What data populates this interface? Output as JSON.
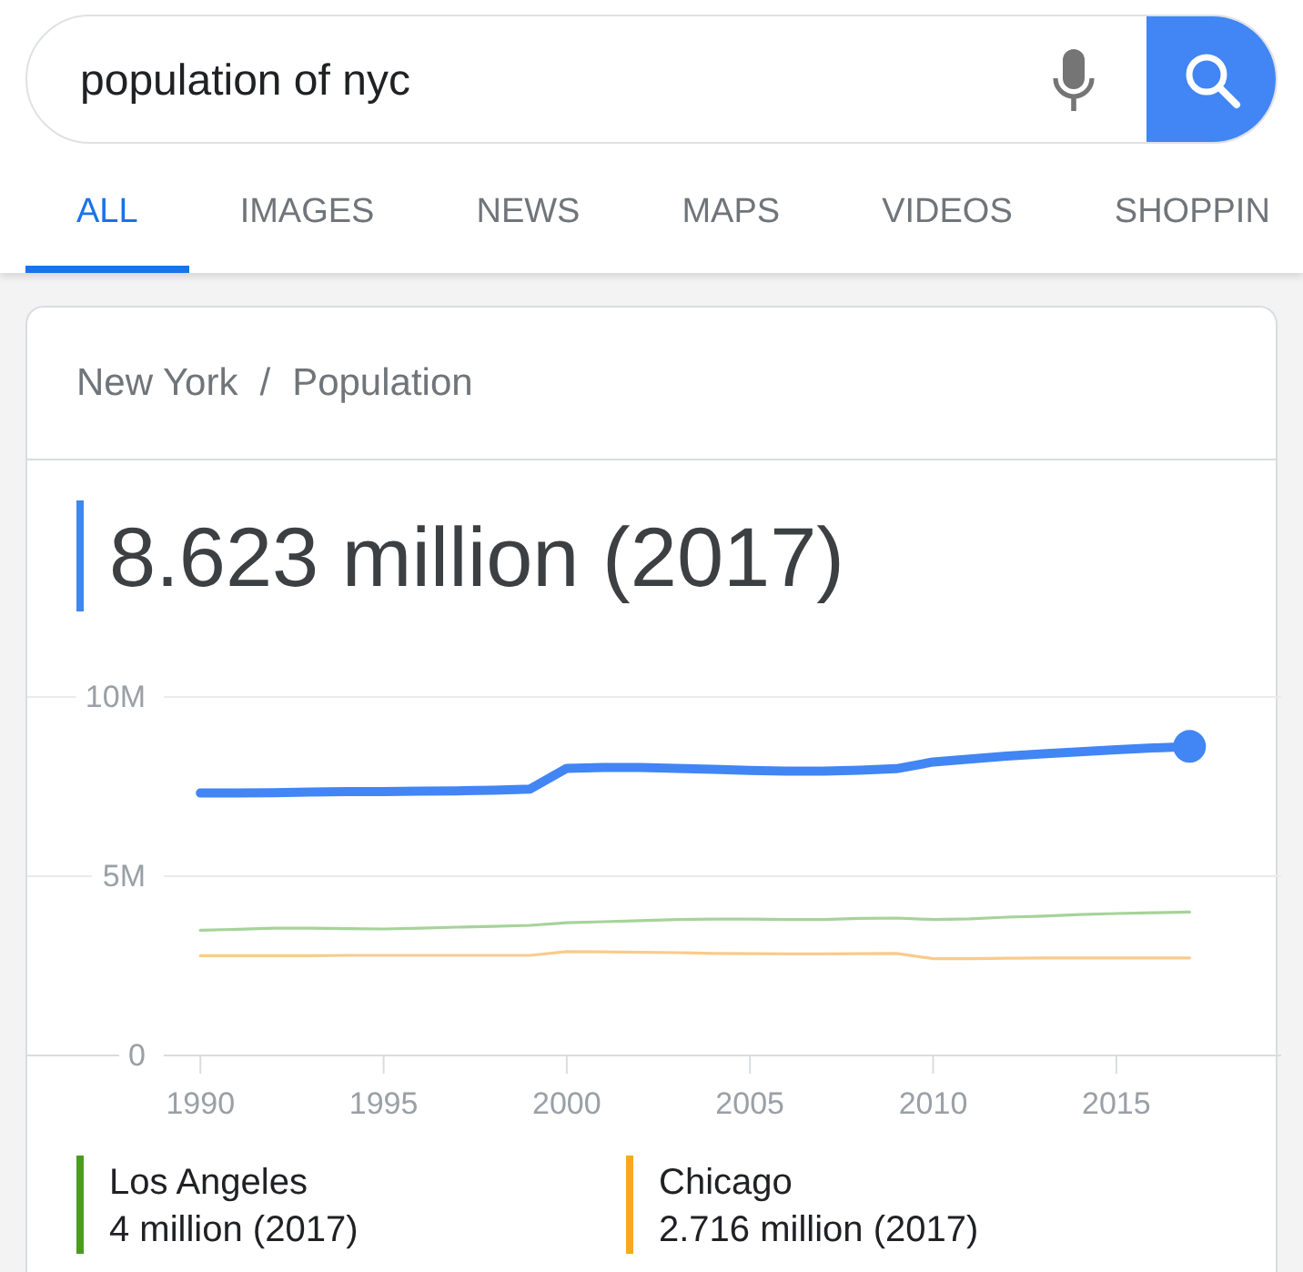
{
  "search": {
    "value": "population of nyc"
  },
  "tabs": [
    {
      "label": "ALL",
      "selected": true
    },
    {
      "label": "IMAGES",
      "selected": false
    },
    {
      "label": "NEWS",
      "selected": false
    },
    {
      "label": "MAPS",
      "selected": false
    },
    {
      "label": "VIDEOS",
      "selected": false
    },
    {
      "label": "SHOPPIN",
      "selected": false
    }
  ],
  "card": {
    "breadcrumb": {
      "parent": "New York",
      "separator": "/",
      "current": "Population"
    },
    "headline": {
      "value": "8.623 million (2017)"
    },
    "chart_data": {
      "type": "line",
      "x": [
        1990,
        1991,
        1992,
        1993,
        1994,
        1995,
        1996,
        1997,
        1998,
        1999,
        2000,
        2001,
        2002,
        2003,
        2004,
        2005,
        2006,
        2007,
        2008,
        2009,
        2010,
        2011,
        2012,
        2013,
        2014,
        2015,
        2016,
        2017
      ],
      "series": [
        {
          "color": "#4285f4",
          "values": [
            7.32,
            7.32,
            7.33,
            7.35,
            7.36,
            7.36,
            7.37,
            7.38,
            7.4,
            7.43,
            8.01,
            8.03,
            8.03,
            8.01,
            7.98,
            7.95,
            7.93,
            7.93,
            7.96,
            8.0,
            8.19,
            8.27,
            8.35,
            8.41,
            8.47,
            8.53,
            8.58,
            8.62
          ]
        },
        {
          "name": "Los Angeles",
          "color": "#a6d39a",
          "values": [
            3.49,
            3.52,
            3.55,
            3.55,
            3.54,
            3.53,
            3.55,
            3.58,
            3.6,
            3.63,
            3.7,
            3.73,
            3.76,
            3.79,
            3.8,
            3.8,
            3.79,
            3.79,
            3.82,
            3.83,
            3.79,
            3.81,
            3.86,
            3.89,
            3.93,
            3.96,
            3.98,
            4.0
          ]
        },
        {
          "name": "Chicago",
          "color": "#f8cb8c",
          "values": [
            2.78,
            2.78,
            2.78,
            2.78,
            2.79,
            2.79,
            2.79,
            2.79,
            2.79,
            2.79,
            2.9,
            2.89,
            2.88,
            2.87,
            2.85,
            2.84,
            2.83,
            2.83,
            2.84,
            2.85,
            2.7,
            2.7,
            2.71,
            2.72,
            2.72,
            2.72,
            2.72,
            2.72
          ]
        }
      ],
      "xlim": [
        1989,
        2019.5
      ],
      "ylim": [
        0,
        10
      ],
      "xticks": [
        1990,
        1995,
        2000,
        2005,
        2010,
        2015
      ],
      "yticks": [
        {
          "value": 0,
          "label": "0"
        },
        {
          "value": 5,
          "label": "5M"
        },
        {
          "value": 10,
          "label": "10M"
        }
      ]
    },
    "legend": [
      {
        "value": "4 million (2017)",
        "color": "#4b9b22"
      },
      {
        "value": "2.716 million (2017)",
        "color": "#f6a91f"
      }
    ]
  }
}
